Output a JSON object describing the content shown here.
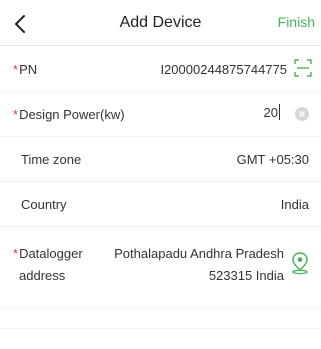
{
  "header": {
    "title": "Add Device",
    "finish_label": "Finish"
  },
  "colors": {
    "accent": "#4bb35a",
    "required": "#e03c3c"
  },
  "form": {
    "required_mark": "*",
    "pn": {
      "label": "PN",
      "value": "I20000244875744775",
      "icon": "scan-icon"
    },
    "design_power": {
      "label": "Design Power(kw)",
      "value": "20",
      "icon": "clear-icon"
    },
    "time_zone": {
      "label": "Time zone",
      "value": "GMT +05:30"
    },
    "country": {
      "label": "Country",
      "value": "India"
    },
    "datalogger_address": {
      "label_line1": "Datalogger",
      "label_line2": "address",
      "value_line1": "Pothalapadu Andhra Pradesh",
      "value_line2": "523315 India",
      "icon": "location-pin-icon"
    }
  }
}
